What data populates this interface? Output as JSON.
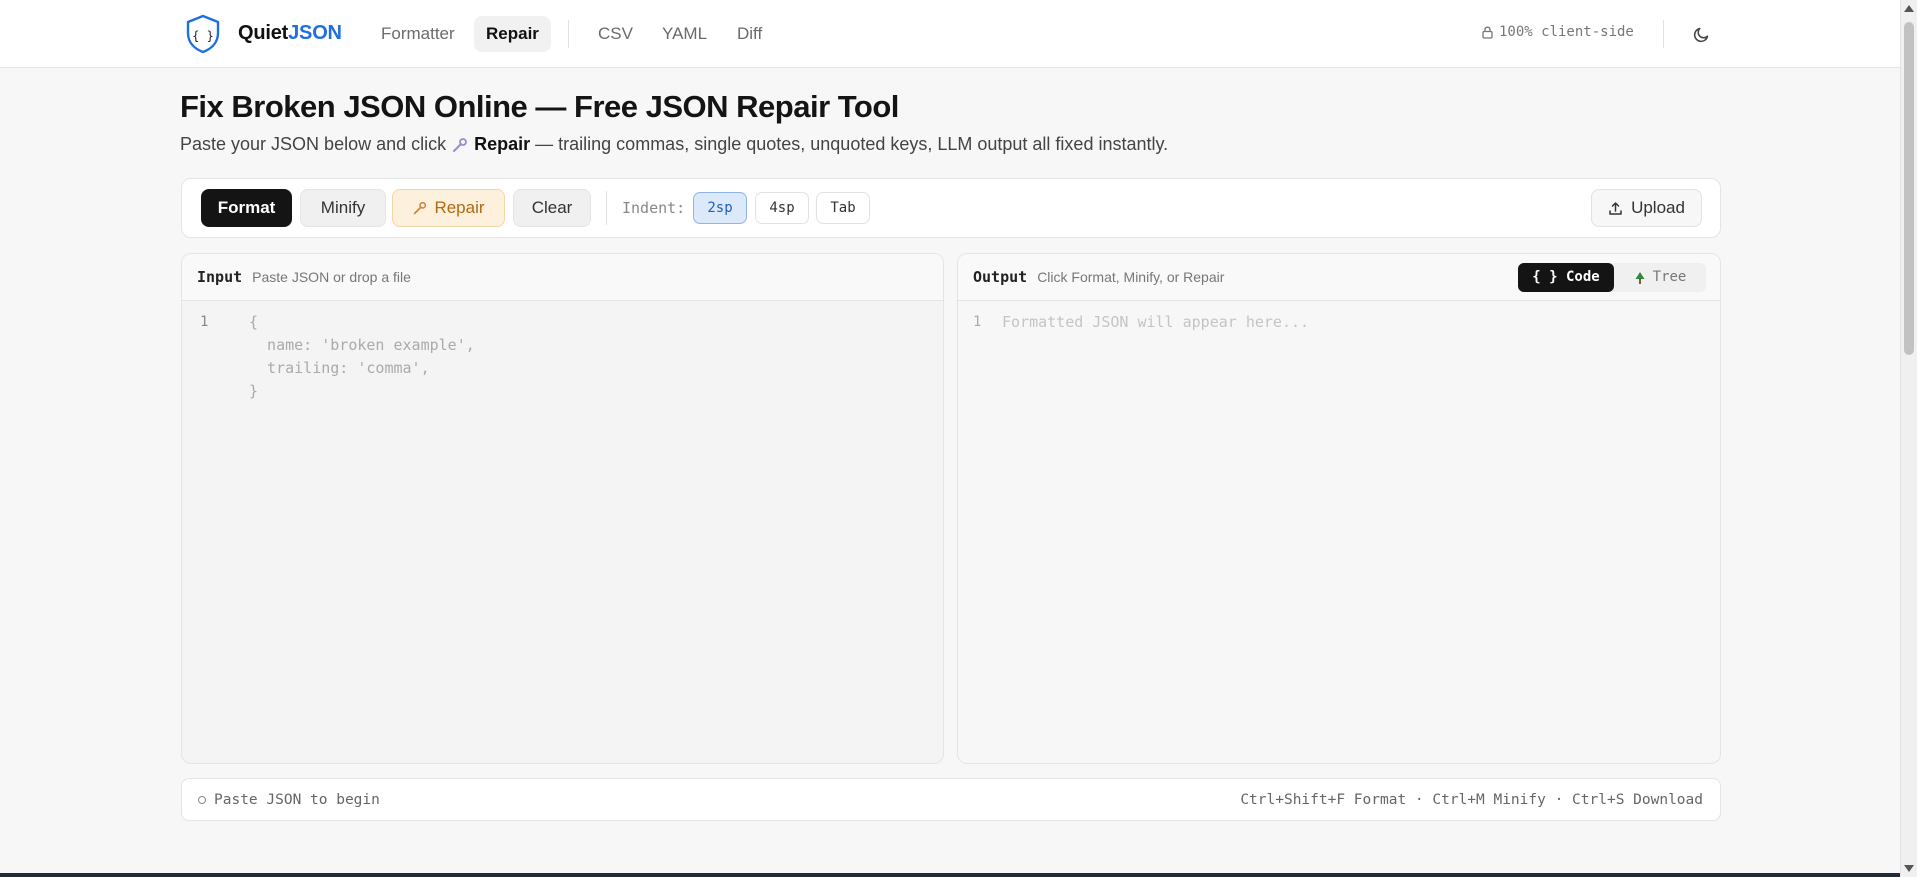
{
  "nav": {
    "brand_part1": "Quiet",
    "brand_part2": "JSON",
    "items": [
      {
        "label": "Formatter",
        "active": false
      },
      {
        "label": "Repair",
        "active": true
      },
      {
        "label": "CSV",
        "active": false
      },
      {
        "label": "YAML",
        "active": false
      },
      {
        "label": "Diff",
        "active": false
      }
    ],
    "client_side": "100% client-side",
    "icons": {
      "logo": "shield-braces-icon",
      "lock": "lock-icon",
      "theme": "moon-icon"
    }
  },
  "header": {
    "title": "Fix Broken JSON Online — Free JSON Repair Tool",
    "sub_before": "Paste your JSON below and click",
    "sub_bold": "Repair",
    "sub_after": "— trailing commas, single quotes, unquoted keys, LLM output all fixed instantly."
  },
  "toolbar": {
    "format": "Format",
    "minify": "Minify",
    "repair": "Repair",
    "clear": "Clear",
    "indent_label": "Indent:",
    "indent_options": [
      "2sp",
      "4sp",
      "Tab"
    ],
    "indent_selected": "2sp",
    "upload": "Upload"
  },
  "input_panel": {
    "title": "Input",
    "hint": "Paste JSON or drop a file",
    "line_number": "1",
    "placeholder": "{\n  name: 'broken example',\n  trailing: 'comma',\n}"
  },
  "output_panel": {
    "title": "Output",
    "hint": "Click Format, Minify, or Repair",
    "line_number": "1",
    "placeholder": "Formatted JSON will appear here...",
    "view_code": "{ } Code",
    "view_tree": "Tree",
    "view_selected": "Code"
  },
  "status": {
    "left": "Paste JSON to begin",
    "shortcuts": "Ctrl+Shift+F Format · Ctrl+M Minify · Ctrl+S Download"
  },
  "colors": {
    "accent_blue": "#1f6fe0",
    "primary_dark": "#141414",
    "repair_bg": "#fdf1de",
    "repair_text": "#b06a12",
    "indent_selected_bg": "#dbe9fb"
  }
}
